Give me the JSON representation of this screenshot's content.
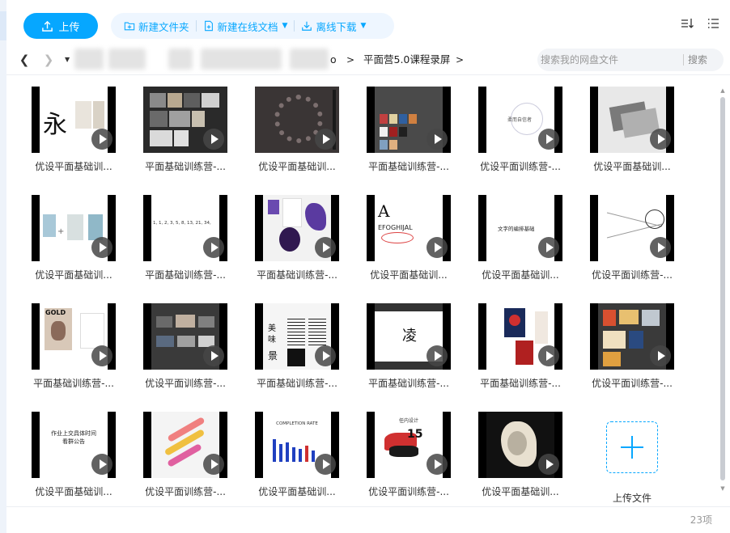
{
  "toolbar": {
    "upload_label": "上传",
    "new_folder_label": "新建文件夹",
    "new_doc_label": "新建在线文档",
    "offline_download_label": "离线下载"
  },
  "breadcrumb": {
    "tail_fragment": "o",
    "current": "平面营5.0课程录屏"
  },
  "search": {
    "placeholder": "搜索我的网盘文件",
    "button_label": "搜索"
  },
  "files": [
    {
      "name": "优设平面基础训..."
    },
    {
      "name": "平面基础训练营-..."
    },
    {
      "name": "优设平面基础训..."
    },
    {
      "name": "平面基础训练营-..."
    },
    {
      "name": "优设平面训练营-..."
    },
    {
      "name": "优设平面基础训..."
    },
    {
      "name": "优设平面基础训..."
    },
    {
      "name": "平面基础训练营-..."
    },
    {
      "name": "平面基础训练营-..."
    },
    {
      "name": "优设平面基础训..."
    },
    {
      "name": "优设平面基础训..."
    },
    {
      "name": "优设平面训练营-..."
    },
    {
      "name": "平面基础训练营-..."
    },
    {
      "name": "优设平面训练营-..."
    },
    {
      "name": "平面基础训练营-..."
    },
    {
      "name": "平面基础训练营-..."
    },
    {
      "name": "平面基础训练营-..."
    },
    {
      "name": "优设平面训练营-..."
    },
    {
      "name": "优设平面基础训..."
    },
    {
      "name": "优设平面训练营-..."
    },
    {
      "name": "优设平面基础训..."
    },
    {
      "name": "优设平面训练营-..."
    },
    {
      "name": "优设平面基础训..."
    }
  ],
  "upload_tile": {
    "label": "上传文件"
  },
  "thumb_text": {
    "t0_char": "永",
    "t4_text": "柔而自信者",
    "t7_a": "A",
    "t7_efg": "EFOGHIJAL",
    "t10_text": "文字的编排基础",
    "t11_text": "1, 1, 2, 3, 5, 8, 13, 21, 34,",
    "t12_logo": "GOLD",
    "t15_char": "凌",
    "t18_line1": "作业上交具体时间",
    "t18_line2": "看群公告",
    "t20_title": "COMPLETION RATE",
    "t21_title": "任内设计",
    "t14_a": "美",
    "t14_b": "味",
    "t14_c": "景"
  },
  "footer": {
    "count_label": "23项"
  },
  "colors": {
    "accent": "#06a7ff"
  }
}
